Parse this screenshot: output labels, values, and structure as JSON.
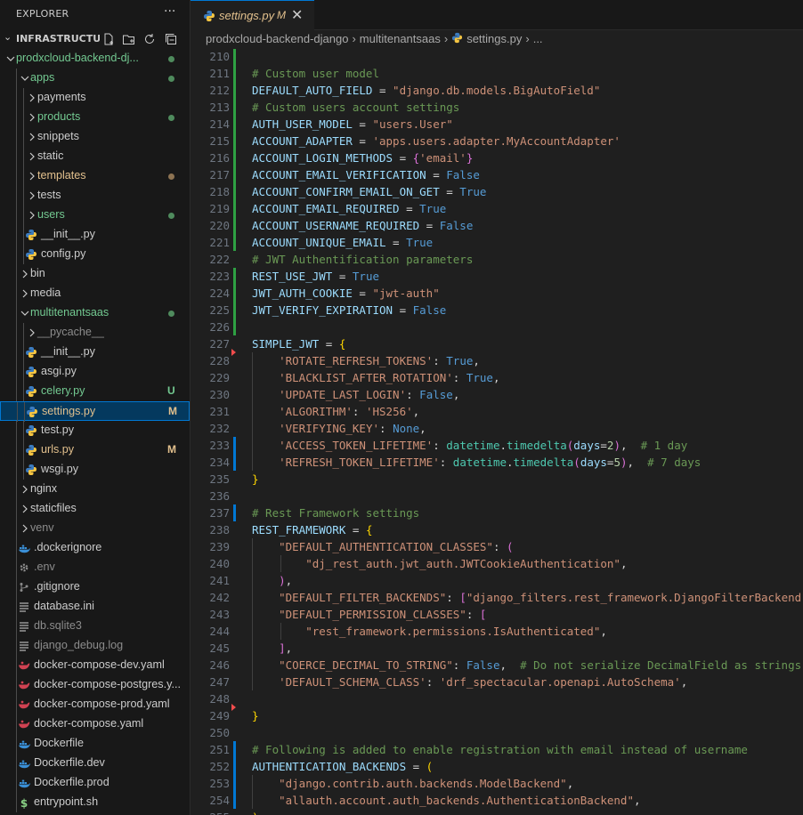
{
  "explorer": {
    "title": "EXPLORER",
    "more": "···",
    "section": "INFRASTRUCTU...",
    "tree": [
      {
        "label": "prodxcloud-backend-dj...",
        "depth": 1,
        "type": "folder",
        "open": true,
        "color": "#73c991",
        "dot": "#4f8b5d"
      },
      {
        "label": "apps",
        "depth": 2,
        "type": "folder",
        "open": true,
        "color": "#73c991",
        "dot": "#4f8b5d"
      },
      {
        "label": "payments",
        "depth": 3,
        "type": "folder",
        "open": false,
        "color": "#cccccc"
      },
      {
        "label": "products",
        "depth": 3,
        "type": "folder",
        "open": false,
        "color": "#73c991",
        "dot": "#4f8b5d"
      },
      {
        "label": "snippets",
        "depth": 3,
        "type": "folder",
        "open": false,
        "color": "#cccccc"
      },
      {
        "label": "static",
        "depth": 3,
        "type": "folder",
        "open": false,
        "color": "#cccccc"
      },
      {
        "label": "templates",
        "depth": 3,
        "type": "folder",
        "open": false,
        "color": "#e2c08d",
        "dot": "#8d7352"
      },
      {
        "label": "tests",
        "depth": 3,
        "type": "folder",
        "open": false,
        "color": "#cccccc"
      },
      {
        "label": "users",
        "depth": 3,
        "type": "folder",
        "open": false,
        "color": "#73c991",
        "dot": "#4f8b5d"
      },
      {
        "label": "__init__.py",
        "depth": 3,
        "type": "file",
        "icon": "python",
        "color": "#cccccc"
      },
      {
        "label": "config.py",
        "depth": 3,
        "type": "file",
        "icon": "python",
        "color": "#cccccc"
      },
      {
        "label": "bin",
        "depth": 2,
        "type": "folder",
        "open": false,
        "color": "#cccccc"
      },
      {
        "label": "media",
        "depth": 2,
        "type": "folder",
        "open": false,
        "color": "#cccccc"
      },
      {
        "label": "multitenantsaas",
        "depth": 2,
        "type": "folder",
        "open": true,
        "color": "#73c991",
        "dot": "#4f8b5d"
      },
      {
        "label": "__pycache__",
        "depth": 3,
        "type": "folder",
        "open": false,
        "color": "#8c8c8c"
      },
      {
        "label": "__init__.py",
        "depth": 3,
        "type": "file",
        "icon": "python",
        "color": "#cccccc"
      },
      {
        "label": "asgi.py",
        "depth": 3,
        "type": "file",
        "icon": "python",
        "color": "#cccccc"
      },
      {
        "label": "celery.py",
        "depth": 3,
        "type": "file",
        "icon": "python",
        "color": "#73c991",
        "badge": "U",
        "badge_color": "#73c991"
      },
      {
        "label": "settings.py",
        "depth": 3,
        "type": "file",
        "icon": "python",
        "color": "#e2c08d",
        "badge": "M",
        "badge_color": "#e2c08d",
        "selected": true
      },
      {
        "label": "test.py",
        "depth": 3,
        "type": "file",
        "icon": "python",
        "color": "#cccccc"
      },
      {
        "label": "urls.py",
        "depth": 3,
        "type": "file",
        "icon": "python",
        "color": "#e2c08d",
        "badge": "M",
        "badge_color": "#e2c08d"
      },
      {
        "label": "wsgi.py",
        "depth": 3,
        "type": "file",
        "icon": "python",
        "color": "#cccccc"
      },
      {
        "label": "nginx",
        "depth": 2,
        "type": "folder",
        "open": false,
        "color": "#cccccc"
      },
      {
        "label": "staticfiles",
        "depth": 2,
        "type": "folder",
        "open": false,
        "color": "#cccccc"
      },
      {
        "label": "venv",
        "depth": 2,
        "type": "folder",
        "open": false,
        "color": "#8c8c8c"
      },
      {
        "label": ".dockerignore",
        "depth": 2,
        "type": "file",
        "icon": "docker",
        "color": "#cccccc"
      },
      {
        "label": ".env",
        "depth": 2,
        "type": "file",
        "icon": "gear",
        "color": "#8c8c8c"
      },
      {
        "label": ".gitignore",
        "depth": 2,
        "type": "file",
        "icon": "git",
        "color": "#cccccc"
      },
      {
        "label": "database.ini",
        "depth": 2,
        "type": "file",
        "icon": "lines",
        "color": "#cccccc"
      },
      {
        "label": "db.sqlite3",
        "depth": 2,
        "type": "file",
        "icon": "lines",
        "color": "#8c8c8c"
      },
      {
        "label": "django_debug.log",
        "depth": 2,
        "type": "file",
        "icon": "lines",
        "color": "#8c8c8c"
      },
      {
        "label": "docker-compose-dev.yaml",
        "depth": 2,
        "type": "file",
        "icon": "compose",
        "color": "#cccccc"
      },
      {
        "label": "docker-compose-postgres.y...",
        "depth": 2,
        "type": "file",
        "icon": "compose",
        "color": "#cccccc"
      },
      {
        "label": "docker-compose-prod.yaml",
        "depth": 2,
        "type": "file",
        "icon": "compose",
        "color": "#cccccc"
      },
      {
        "label": "docker-compose.yaml",
        "depth": 2,
        "type": "file",
        "icon": "compose",
        "color": "#cccccc"
      },
      {
        "label": "Dockerfile",
        "depth": 2,
        "type": "file",
        "icon": "docker",
        "color": "#cccccc"
      },
      {
        "label": "Dockerfile.dev",
        "depth": 2,
        "type": "file",
        "icon": "docker",
        "color": "#cccccc"
      },
      {
        "label": "Dockerfile.prod",
        "depth": 2,
        "type": "file",
        "icon": "docker",
        "color": "#cccccc"
      },
      {
        "label": "entrypoint.sh",
        "depth": 2,
        "type": "file",
        "icon": "shell",
        "color": "#cccccc"
      }
    ]
  },
  "tab": {
    "name": "settings.py",
    "modified": "M",
    "close": "✕"
  },
  "breadcrumb": [
    "prodxcloud-backend-django",
    "multitenantsaas",
    "settings.py",
    "..."
  ],
  "icons": {
    "python": "python-icon",
    "docker": "docker-icon",
    "gear": "gear-icon",
    "git": "git-icon",
    "lines": "file-lines-icon",
    "compose": "docker-compose-icon",
    "shell": "shell-icon"
  },
  "code": [
    {
      "n": "210",
      "gut": "add",
      "tokens": []
    },
    {
      "n": "211",
      "gut": "add",
      "tokens": [
        [
          "c",
          "# Custom user model"
        ]
      ]
    },
    {
      "n": "212",
      "gut": "add",
      "tokens": [
        [
          "v",
          "DEFAULT_AUTO_FIELD"
        ],
        [
          "o",
          " = "
        ],
        [
          "s",
          "\"django.db.models.BigAutoField\""
        ]
      ]
    },
    {
      "n": "213",
      "gut": "add",
      "tokens": [
        [
          "c",
          "# Custom users account settings"
        ]
      ]
    },
    {
      "n": "214",
      "gut": "add",
      "tokens": [
        [
          "v",
          "AUTH_USER_MODEL"
        ],
        [
          "o",
          " = "
        ],
        [
          "s",
          "\"users.User\""
        ]
      ]
    },
    {
      "n": "215",
      "gut": "add",
      "tokens": [
        [
          "v",
          "ACCOUNT_ADAPTER"
        ],
        [
          "o",
          " = "
        ],
        [
          "s",
          "'apps.users.adapter.MyAccountAdapter'"
        ]
      ]
    },
    {
      "n": "216",
      "gut": "add",
      "tokens": [
        [
          "v",
          "ACCOUNT_LOGIN_METHODS"
        ],
        [
          "o",
          " = "
        ],
        [
          "b2",
          "{"
        ],
        [
          "s",
          "'email'"
        ],
        [
          "b2",
          "}"
        ]
      ]
    },
    {
      "n": "217",
      "gut": "add",
      "tokens": [
        [
          "v",
          "ACCOUNT_EMAIL_VERIFICATION"
        ],
        [
          "o",
          " = "
        ],
        [
          "k",
          "False"
        ]
      ]
    },
    {
      "n": "218",
      "gut": "add",
      "tokens": [
        [
          "v",
          "ACCOUNT_CONFIRM_EMAIL_ON_GET"
        ],
        [
          "o",
          " = "
        ],
        [
          "k",
          "True"
        ]
      ]
    },
    {
      "n": "219",
      "gut": "add",
      "tokens": [
        [
          "v",
          "ACCOUNT_EMAIL_REQUIRED"
        ],
        [
          "o",
          " = "
        ],
        [
          "k",
          "True"
        ]
      ]
    },
    {
      "n": "220",
      "gut": "add",
      "tokens": [
        [
          "v",
          "ACCOUNT_USERNAME_REQUIRED"
        ],
        [
          "o",
          " = "
        ],
        [
          "k",
          "False"
        ]
      ]
    },
    {
      "n": "221",
      "gut": "add",
      "tokens": [
        [
          "v",
          "ACCOUNT_UNIQUE_EMAIL"
        ],
        [
          "o",
          " = "
        ],
        [
          "k",
          "True"
        ]
      ]
    },
    {
      "n": "222",
      "gut": "",
      "tokens": [
        [
          "c",
          "# JWT Authentification parameters"
        ]
      ]
    },
    {
      "n": "223",
      "gut": "add",
      "tokens": [
        [
          "v",
          "REST_USE_JWT"
        ],
        [
          "o",
          " = "
        ],
        [
          "k",
          "True"
        ]
      ]
    },
    {
      "n": "224",
      "gut": "add",
      "tokens": [
        [
          "v",
          "JWT_AUTH_COOKIE"
        ],
        [
          "o",
          " = "
        ],
        [
          "s",
          "\"jwt-auth\""
        ]
      ]
    },
    {
      "n": "225",
      "gut": "add",
      "tokens": [
        [
          "v",
          "JWT_VERIFY_EXPIRATION"
        ],
        [
          "o",
          " = "
        ],
        [
          "k",
          "False"
        ]
      ]
    },
    {
      "n": "226",
      "gut": "add",
      "tokens": []
    },
    {
      "n": "227",
      "gut": "",
      "tokens": [
        [
          "v",
          "SIMPLE_JWT"
        ],
        [
          "o",
          " = "
        ],
        [
          "b1",
          "{"
        ]
      ]
    },
    {
      "n": "228",
      "gut": "del",
      "tokens": [
        [
          "o",
          "    "
        ],
        [
          "s",
          "'ROTATE_REFRESH_TOKENS'"
        ],
        [
          "o",
          ": "
        ],
        [
          "k",
          "True"
        ],
        [
          "o",
          ","
        ]
      ]
    },
    {
      "n": "229",
      "gut": "",
      "tokens": [
        [
          "o",
          "    "
        ],
        [
          "s",
          "'BLACKLIST_AFTER_ROTATION'"
        ],
        [
          "o",
          ": "
        ],
        [
          "k",
          "True"
        ],
        [
          "o",
          ","
        ]
      ]
    },
    {
      "n": "230",
      "gut": "",
      "tokens": [
        [
          "o",
          "    "
        ],
        [
          "s",
          "'UPDATE_LAST_LOGIN'"
        ],
        [
          "o",
          ": "
        ],
        [
          "k",
          "False"
        ],
        [
          "o",
          ","
        ]
      ]
    },
    {
      "n": "231",
      "gut": "",
      "tokens": [
        [
          "o",
          "    "
        ],
        [
          "s",
          "'ALGORITHM'"
        ],
        [
          "o",
          ": "
        ],
        [
          "s",
          "'HS256'"
        ],
        [
          "o",
          ","
        ]
      ]
    },
    {
      "n": "232",
      "gut": "",
      "tokens": [
        [
          "o",
          "    "
        ],
        [
          "s",
          "'VERIFYING_KEY'"
        ],
        [
          "o",
          ": "
        ],
        [
          "k",
          "None"
        ],
        [
          "o",
          ","
        ]
      ]
    },
    {
      "n": "233",
      "gut": "mod",
      "tokens": [
        [
          "o",
          "    "
        ],
        [
          "s",
          "'ACCESS_TOKEN_LIFETIME'"
        ],
        [
          "o",
          ": "
        ],
        [
          "m",
          "datetime"
        ],
        [
          "o",
          "."
        ],
        [
          "m",
          "timedelta"
        ],
        [
          "b2",
          "("
        ],
        [
          "v",
          "days"
        ],
        [
          "o",
          "="
        ],
        [
          "n",
          "2"
        ],
        [
          "b2",
          ")"
        ],
        [
          "o",
          ",  "
        ],
        [
          "c",
          "# 1 day"
        ]
      ]
    },
    {
      "n": "234",
      "gut": "mod",
      "tokens": [
        [
          "o",
          "    "
        ],
        [
          "s",
          "'REFRESH_TOKEN_LIFETIME'"
        ],
        [
          "o",
          ": "
        ],
        [
          "m",
          "datetime"
        ],
        [
          "o",
          "."
        ],
        [
          "m",
          "timedelta"
        ],
        [
          "b2",
          "("
        ],
        [
          "v",
          "days"
        ],
        [
          "o",
          "="
        ],
        [
          "n",
          "5"
        ],
        [
          "b2",
          ")"
        ],
        [
          "o",
          ",  "
        ],
        [
          "c",
          "# 7 days"
        ]
      ]
    },
    {
      "n": "235",
      "gut": "",
      "tokens": [
        [
          "b1",
          "}"
        ]
      ]
    },
    {
      "n": "236",
      "gut": "",
      "tokens": []
    },
    {
      "n": "237",
      "gut": "mod",
      "tokens": [
        [
          "c",
          "# Rest Framework settings"
        ]
      ]
    },
    {
      "n": "238",
      "gut": "",
      "tokens": [
        [
          "v",
          "REST_FRAMEWORK"
        ],
        [
          "o",
          " = "
        ],
        [
          "b1",
          "{"
        ]
      ]
    },
    {
      "n": "239",
      "gut": "",
      "tokens": [
        [
          "o",
          "    "
        ],
        [
          "s",
          "\"DEFAULT_AUTHENTICATION_CLASSES\""
        ],
        [
          "o",
          ": "
        ],
        [
          "b2",
          "("
        ]
      ]
    },
    {
      "n": "240",
      "gut": "",
      "tokens": [
        [
          "o",
          "        "
        ],
        [
          "s",
          "\"dj_rest_auth.jwt_auth.JWTCookieAuthentication\""
        ],
        [
          "o",
          ","
        ]
      ]
    },
    {
      "n": "241",
      "gut": "",
      "tokens": [
        [
          "o",
          "    "
        ],
        [
          "b2",
          ")"
        ],
        [
          "o",
          ","
        ]
      ]
    },
    {
      "n": "242",
      "gut": "",
      "tokens": [
        [
          "o",
          "    "
        ],
        [
          "s",
          "\"DEFAULT_FILTER_BACKENDS\""
        ],
        [
          "o",
          ": "
        ],
        [
          "b2",
          "["
        ],
        [
          "s",
          "\"django_filters.rest_framework.DjangoFilterBackend\""
        ],
        [
          "b2",
          "]"
        ],
        [
          "o",
          ","
        ]
      ]
    },
    {
      "n": "243",
      "gut": "",
      "tokens": [
        [
          "o",
          "    "
        ],
        [
          "s",
          "\"DEFAULT_PERMISSION_CLASSES\""
        ],
        [
          "o",
          ": "
        ],
        [
          "b2",
          "["
        ]
      ]
    },
    {
      "n": "244",
      "gut": "",
      "tokens": [
        [
          "o",
          "        "
        ],
        [
          "s",
          "\"rest_framework.permissions.IsAuthenticated\""
        ],
        [
          "o",
          ","
        ]
      ]
    },
    {
      "n": "245",
      "gut": "",
      "tokens": [
        [
          "o",
          "    "
        ],
        [
          "b2",
          "]"
        ],
        [
          "o",
          ","
        ]
      ]
    },
    {
      "n": "246",
      "gut": "",
      "tokens": [
        [
          "o",
          "    "
        ],
        [
          "s",
          "\"COERCE_DECIMAL_TO_STRING\""
        ],
        [
          "o",
          ": "
        ],
        [
          "k",
          "False"
        ],
        [
          "o",
          ",  "
        ],
        [
          "c",
          "# Do not serialize DecimalField as strings"
        ]
      ]
    },
    {
      "n": "247",
      "gut": "",
      "tokens": [
        [
          "o",
          "    "
        ],
        [
          "s",
          "'DEFAULT_SCHEMA_CLASS'"
        ],
        [
          "o",
          ": "
        ],
        [
          "s",
          "'drf_spectacular.openapi.AutoSchema'"
        ],
        [
          "o",
          ","
        ]
      ]
    },
    {
      "n": "248",
      "gut": "",
      "tokens": []
    },
    {
      "n": "249",
      "gut": "del",
      "tokens": [
        [
          "b1",
          "}"
        ]
      ]
    },
    {
      "n": "250",
      "gut": "",
      "tokens": []
    },
    {
      "n": "251",
      "gut": "mod",
      "tokens": [
        [
          "c",
          "# Following is added to enable registration with email instead of username"
        ]
      ]
    },
    {
      "n": "252",
      "gut": "mod",
      "tokens": [
        [
          "v",
          "AUTHENTICATION_BACKENDS"
        ],
        [
          "o",
          " = "
        ],
        [
          "b1",
          "("
        ]
      ]
    },
    {
      "n": "253",
      "gut": "mod",
      "tokens": [
        [
          "o",
          "    "
        ],
        [
          "s",
          "\"django.contrib.auth.backends.ModelBackend\""
        ],
        [
          "o",
          ","
        ]
      ]
    },
    {
      "n": "254",
      "gut": "mod",
      "tokens": [
        [
          "o",
          "    "
        ],
        [
          "s",
          "\"allauth.account.auth_backends.AuthenticationBackend\""
        ],
        [
          "o",
          ","
        ]
      ]
    },
    {
      "n": "255",
      "gut": "",
      "tokens": [
        [
          "b1",
          ")"
        ]
      ]
    }
  ]
}
